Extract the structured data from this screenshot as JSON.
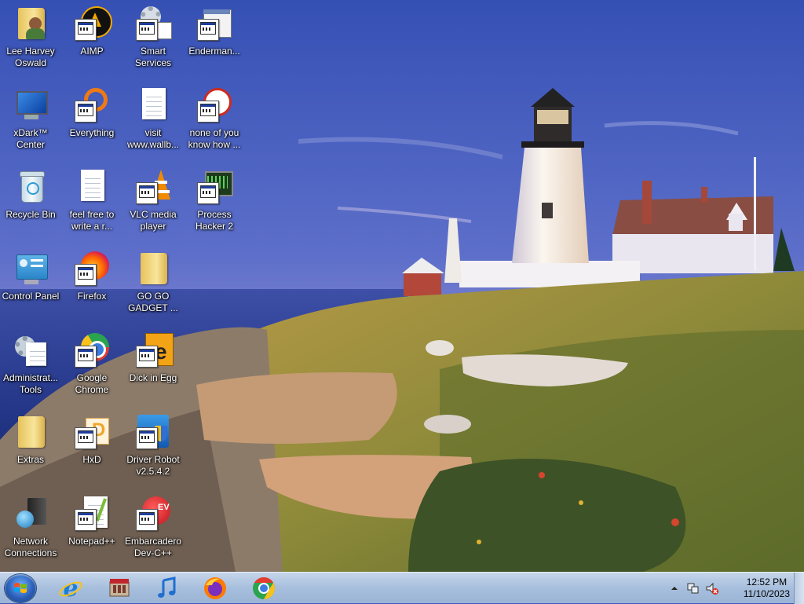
{
  "desktop": {
    "icons": [
      {
        "label": "Lee Harvey\nOswald",
        "icon": "folder-user-icon"
      },
      {
        "label": "AIMP",
        "icon": "aimp-icon"
      },
      {
        "label": "Smart\nServices",
        "icon": "gears-icon"
      },
      {
        "label": "Enderman...",
        "icon": "app-window-icon"
      },
      {
        "label": "xDark™\nCenter",
        "icon": "monitor-icon"
      },
      {
        "label": "Everything",
        "icon": "everything-search-icon"
      },
      {
        "label": "visit\nwww.wallb...",
        "icon": "text-document-icon"
      },
      {
        "label": "none of you\nknow how ...",
        "icon": "app-icon"
      },
      {
        "label": "Recycle Bin",
        "icon": "recycle-bin-icon"
      },
      {
        "label": "feel free to\nwrite a r...",
        "icon": "text-document-icon"
      },
      {
        "label": "VLC media\nplayer",
        "icon": "vlc-cone-icon"
      },
      {
        "label": "Process\nHacker 2",
        "icon": "process-hacker-icon"
      },
      {
        "label": "Control Panel",
        "icon": "control-panel-icon"
      },
      {
        "label": "Firefox",
        "icon": "firefox-icon"
      },
      {
        "label": "GO GO\nGADGET ...",
        "icon": "folder-icon"
      },
      {
        "label": "Administrat...\nTools",
        "icon": "admin-tools-icon"
      },
      {
        "label": "Google\nChrome",
        "icon": "chrome-icon"
      },
      {
        "label": "Dick in Egg",
        "icon": "dick-in-egg-icon"
      },
      {
        "label": "Extras",
        "icon": "folder-icon"
      },
      {
        "label": "HxD",
        "icon": "hxd-icon"
      },
      {
        "label": "Driver Robot\nv2.5.4.2",
        "icon": "driver-robot-shield-icon"
      },
      {
        "label": "Network\nConnections",
        "icon": "network-icon"
      },
      {
        "label": "Notepad++",
        "icon": "notepad-plus-plus-icon"
      },
      {
        "label": "Embarcadero\nDev-C++",
        "icon": "devcpp-icon"
      }
    ]
  },
  "taskbar": {
    "start_icon": "windows-start-orb-icon",
    "pinned": [
      {
        "name": "internet-explorer",
        "icon": "internet-explorer-icon"
      },
      {
        "name": "media-center",
        "icon": "media-center-icon"
      },
      {
        "name": "music",
        "icon": "music-note-icon"
      },
      {
        "name": "firefox",
        "icon": "firefox-icon"
      },
      {
        "name": "chrome",
        "icon": "chrome-icon"
      }
    ],
    "tray": {
      "time": "12:52 PM",
      "date": "11/10/2023"
    }
  },
  "colors": {
    "taskbar": "#a7bfdd",
    "sky_top": "#3a55b6",
    "sky_bottom": "#b9a9d6",
    "sea": "#2a3d8f"
  }
}
